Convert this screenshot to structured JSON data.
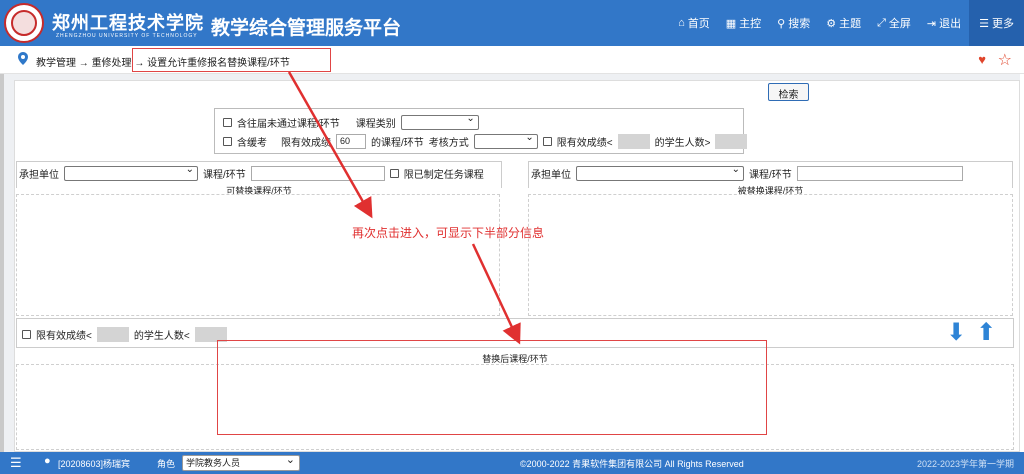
{
  "header": {
    "school_name": "郑州工程技术学院",
    "school_name_en": "ZHENGZHOU UNIVERSITY OF TECHNOLOGY",
    "platform_title": "教学综合管理服务平台",
    "nav": [
      {
        "label": "首页",
        "icon": "home-icon"
      },
      {
        "label": "主控",
        "icon": "windows-icon"
      },
      {
        "label": "搜索",
        "icon": "search-icon"
      },
      {
        "label": "主题",
        "icon": "gears-icon"
      },
      {
        "label": "全屏",
        "icon": "fullscreen-icon"
      },
      {
        "label": "退出",
        "icon": "logout-icon"
      },
      {
        "label": "更多",
        "icon": "menu-icon"
      }
    ]
  },
  "breadcrumb": {
    "items": [
      "教学管理",
      "重修处理",
      "设置允许重修报名替换课程/环节"
    ],
    "sep": "→"
  },
  "search_button": "检索",
  "filter": {
    "include_past_failed": "含往届未通过课程/环节",
    "course_category": "课程类别",
    "include_deferred": "含缓考",
    "valid_score_limit": "限有效成绩",
    "valid_score_value": "60",
    "course_suffix": "的课程/环节",
    "exam_method": "考核方式",
    "valid_score_lt": "限有效成绩<",
    "student_count": "的学生人数>"
  },
  "left_section": {
    "dept_label": "承担单位",
    "course_label": "课程/环节",
    "task_label": "限已制定任务课程",
    "caption": "可替换课程/环节"
  },
  "right_section": {
    "dept_label": "承担单位",
    "course_label": "课程/环节",
    "caption": "被替换课程/环节"
  },
  "middle": {
    "valid_score_lt": "限有效成绩<",
    "student_count": "的学生人数<"
  },
  "bottom_caption": "替换后课程/环节",
  "annotation": "再次点击进入，可显示下半部分信息",
  "footer": {
    "user": "[20208603]杨瑞宾",
    "role_label": "角色",
    "role_value": "学院教务人员",
    "copyright": "©2000-2022 青果软件集团有限公司 All Rights Reserved",
    "term": "2022-2023学年第一学期"
  },
  "colors": {
    "header": "#3277c8",
    "annotation": "#e03030",
    "arrow": "#2e84d6"
  }
}
